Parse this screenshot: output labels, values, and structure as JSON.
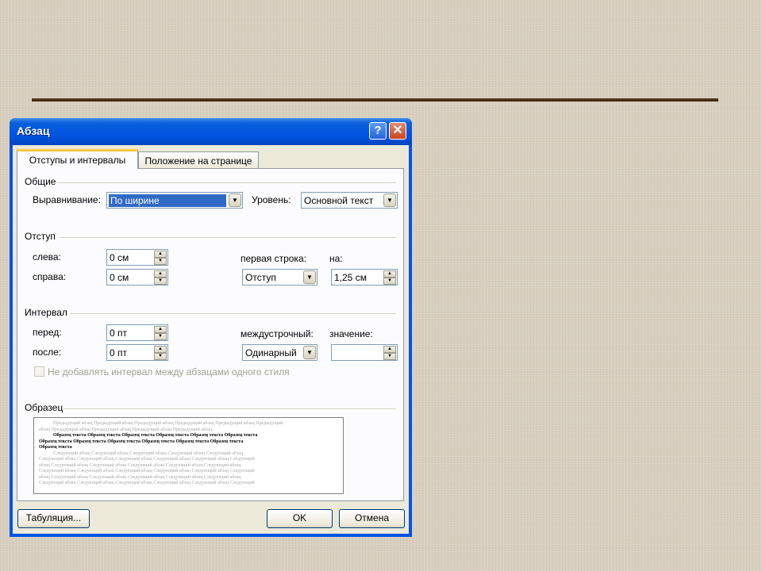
{
  "window": {
    "title": "Абзац",
    "help_label": "?",
    "close_label": "✕"
  },
  "tabs": [
    {
      "label": "Отступы и интервалы",
      "selected": true
    },
    {
      "label": "Положение на странице",
      "selected": false
    }
  ],
  "general": {
    "title": "Общие",
    "alignment_label": "Выравнивание:",
    "alignment_value": "По ширине",
    "level_label": "Уровень:",
    "level_value": "Основной текст"
  },
  "indent": {
    "title": "Отступ",
    "left_label": "слева:",
    "left_value": "0 см",
    "right_label": "справа:",
    "right_value": "0 см",
    "first_line_label": "первая строка:",
    "first_line_value": "Отступ",
    "by_label": "на:",
    "by_value": "1,25 см"
  },
  "spacing": {
    "title": "Интервал",
    "before_label": "перед:",
    "before_value": "0 пт",
    "after_label": "после:",
    "after_value": "0 пт",
    "line_label": "междустрочный:",
    "line_value": "Одинарный",
    "at_label": "значение:",
    "at_value": "",
    "no_space_label": "Не добавлять интервал между абзацами одного стиля",
    "no_space_checked": false
  },
  "preview": {
    "title": "Образец",
    "prev_lines": [
      "Предыдущий абзац Предыдущий абзац Предыдущий абзац Предыдущий абзац Предыдущий абзац Предыдущий",
      "абзац Предыдущий абзац Предыдущий абзац Предыдущий абзац Предыдущий абзац"
    ],
    "sample_lines": [
      "Образец текста Образец текста Образец текста Образец текста Образец текста Образец текста",
      "Образец текста Образец текста Образец текста Образец текста Образец текста Образец текста",
      "Образец текста"
    ],
    "next_lines": [
      "Следующий абзац Следующий абзац Следующий абзац Следующий абзац Следующий абзац",
      "Следующий абзац Следующий абзац Следующий абзац Следующий абзац Следующий абзац Следующий",
      "абзац Следующий абзац Следующий абзац Следующий абзац Следующий абзац Следующий абзац",
      "Следующий абзац Следующий абзац Следующий абзац Следующий абзац Следующий абзац Следующий",
      "абзац Следующий абзац Следующий абзац Следующий абзац Следующий абзац Следующий абзац",
      "Следующий абзац Следующий абзац Следующий абзац Следующий абзац Следующий абзац Следующий"
    ]
  },
  "buttons": {
    "tabs": "Табуляция...",
    "ok": "OK",
    "cancel": "Отмена"
  },
  "colors": {
    "titlebar": "#0054e3",
    "dialog_bg": "#ece9d8",
    "selection": "#316ac5",
    "background": "#d8cfbf",
    "rule": "#4a2e14"
  }
}
